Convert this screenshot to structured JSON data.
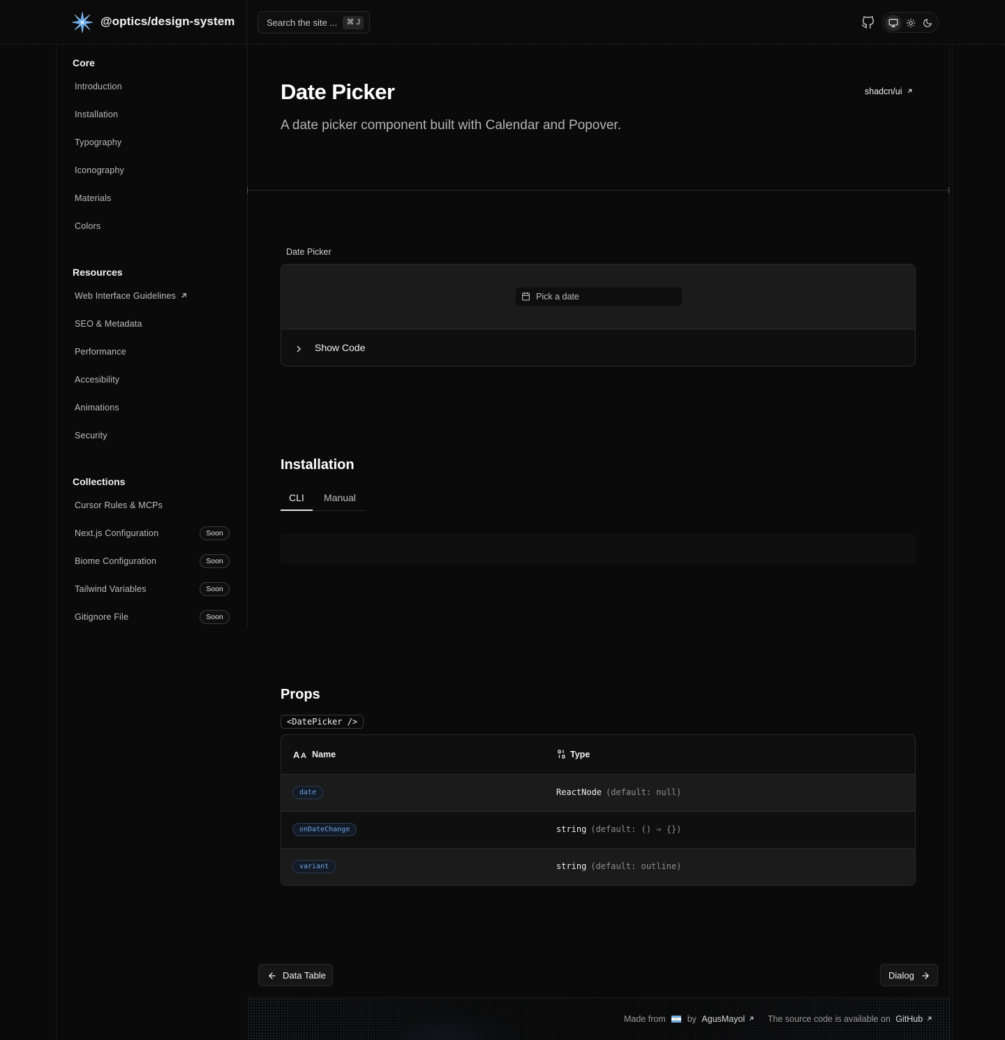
{
  "header": {
    "site_name": "@optics/design-system",
    "search_placeholder": "Search the site ...",
    "search_shortcut": "⌘ J",
    "github_icon": "github-icon",
    "theme_options": [
      "system",
      "light",
      "dark"
    ],
    "theme_selected": "system"
  },
  "sidebar": {
    "sections": [
      {
        "title": "Core",
        "items": [
          {
            "label": "Introduction"
          },
          {
            "label": "Installation"
          },
          {
            "label": "Typography"
          },
          {
            "label": "Iconography"
          },
          {
            "label": "Materials"
          },
          {
            "label": "Colors"
          }
        ]
      },
      {
        "title": "Resources",
        "items": [
          {
            "label": "Web Interface Guidelines",
            "external": true
          },
          {
            "label": "SEO & Metadata"
          },
          {
            "label": "Performance"
          },
          {
            "label": "Accesibility"
          },
          {
            "label": "Animations"
          },
          {
            "label": "Security"
          }
        ]
      },
      {
        "title": "Collections",
        "items": [
          {
            "label": "Cursor Rules & MCPs"
          },
          {
            "label": "Next.js Configuration",
            "badge": "Soon"
          },
          {
            "label": "Biome Configuration",
            "badge": "Soon"
          },
          {
            "label": "Tailwind Variables",
            "badge": "Soon"
          },
          {
            "label": "Gitignore File",
            "badge": "Soon"
          }
        ]
      }
    ]
  },
  "page": {
    "title": "Date Picker",
    "description": "A date picker component built with Calendar and Popover.",
    "external_link": "shadcn/ui"
  },
  "demo": {
    "label": "Date Picker",
    "button_text": "Pick a date",
    "show_code": "Show Code"
  },
  "installation": {
    "heading": "Installation",
    "tabs": [
      "CLI",
      "Manual"
    ],
    "active_tab": "CLI"
  },
  "props": {
    "heading": "Props",
    "component": "<DatePicker />",
    "columns": [
      "Name",
      "Type"
    ],
    "rows": [
      {
        "name": "date",
        "type": "ReactNode",
        "default": "(default: null)"
      },
      {
        "name": "onDateChange",
        "type": "string",
        "default": "(default: () ⇒ {})"
      },
      {
        "name": "variant",
        "type": "string",
        "default": "(default: outline)"
      }
    ]
  },
  "pager": {
    "prev": "Data Table",
    "next": "Dialog"
  },
  "footer": {
    "made_from": "Made from",
    "by": "by",
    "author": "AgusMayol",
    "source_text": "The source code is available on",
    "source_link": "GitHub"
  },
  "colors": {
    "background": "#0a0a0a",
    "accent_pill": "#6fa3e6",
    "logo": "#5ea8f0"
  }
}
